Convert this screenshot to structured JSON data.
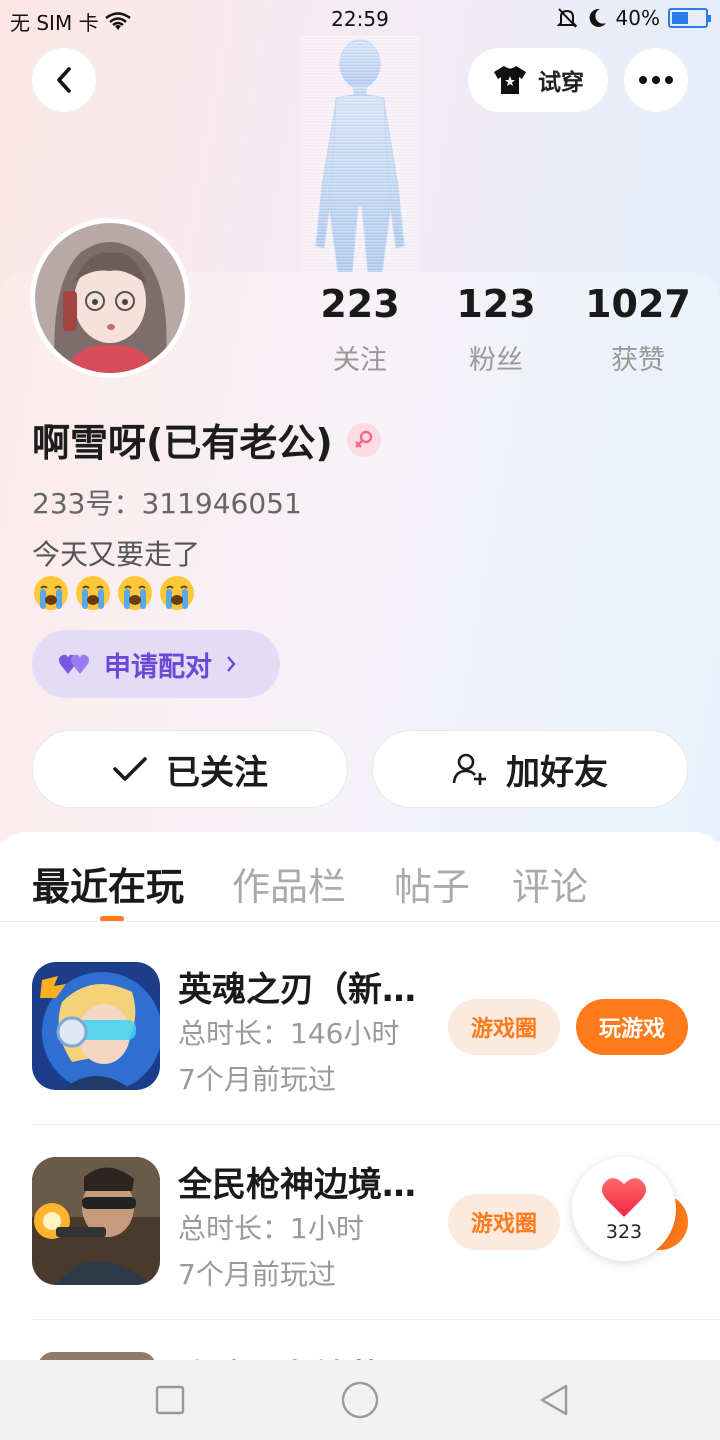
{
  "status_bar": {
    "carrier": "无 SIM 卡",
    "time": "22:59",
    "battery": "40%"
  },
  "header": {
    "try_on_label": "试穿"
  },
  "profile": {
    "stats": [
      {
        "value": "223",
        "label": "关注"
      },
      {
        "value": "123",
        "label": "粉丝"
      },
      {
        "value": "1027",
        "label": "获赞"
      }
    ],
    "name": "啊雪呀(已有老公)",
    "uid": "233号：311946051",
    "bio": "今天又要走了",
    "pair_label": "申请配对",
    "follow_label": "已关注",
    "add_friend_label": "加好友"
  },
  "tabs": [
    {
      "label": "最近在玩",
      "active": true
    },
    {
      "label": "作品栏",
      "active": false
    },
    {
      "label": "帖子",
      "active": false
    },
    {
      "label": "评论",
      "active": false
    }
  ],
  "games": [
    {
      "title": "英魂之刃（新…",
      "playtime": "总时长：146小时",
      "last_played": "7个月前玩过",
      "circle_label": "游戏圈",
      "play_label": "玩游戏"
    },
    {
      "title": "全民枪神边境…",
      "playtime": "总时长：1小时",
      "last_played": "7个月前玩过",
      "circle_label": "游戏圈"
    }
  ],
  "partial_game_title": "玫瑰三老精英",
  "like_float": {
    "count": "323"
  },
  "colors": {
    "accent": "#ff7a1a",
    "pair_purple": "#6b48d6",
    "battery_blue": "#2b7be8"
  }
}
